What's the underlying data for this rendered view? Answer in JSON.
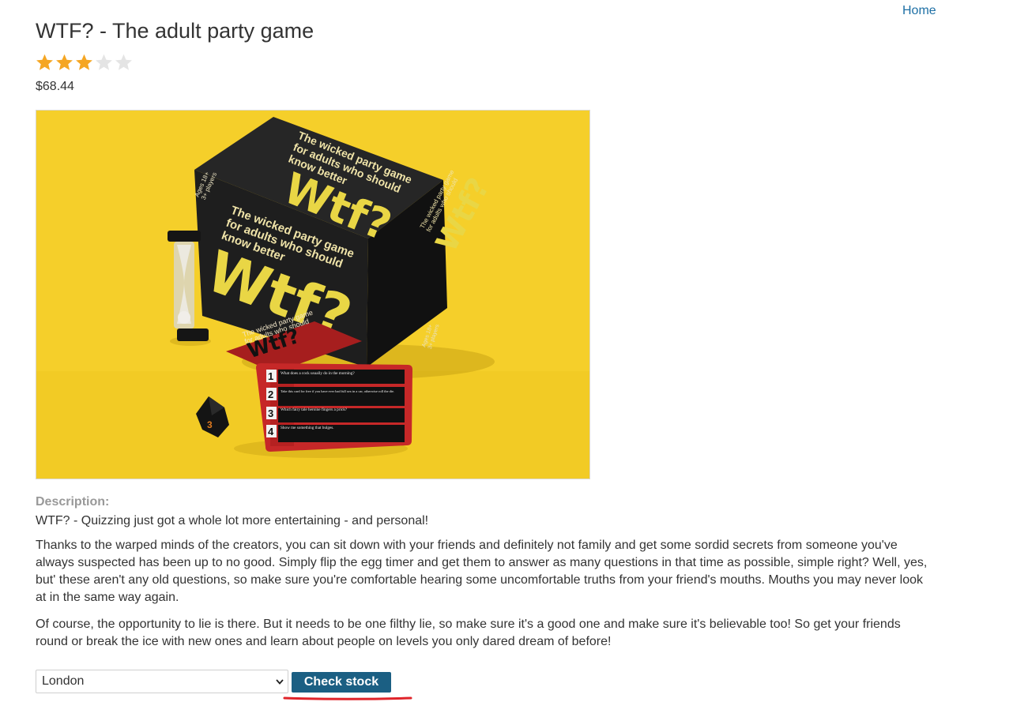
{
  "nav": {
    "home_label": "Home"
  },
  "product": {
    "title": "WTF? - The adult party game",
    "rating": 3,
    "rating_max": 5,
    "price": "$68.44",
    "image_alt": "WTF? - The adult party game",
    "image_text": {
      "box_tagline_lines": [
        "The wicked party game",
        "for adults who should",
        "know better"
      ],
      "logo": "Wtf?",
      "age_badge": "Ages 18+",
      "players_badge": "3+ players",
      "card_numbers": [
        "1",
        "2",
        "3",
        "4"
      ],
      "card_questions": [
        "What does a cock usually do in the morning?",
        "Take this card for free if you have ever had full sex in a car, otherwise roll the die.",
        "Which fairy tale heroine fingers a prick?",
        "Show me something that bulges."
      ],
      "die_number": "3"
    }
  },
  "description": {
    "label": "Description:",
    "paragraphs": [
      "WTF? - Quizzing just got a whole lot more entertaining - and personal!",
      "Thanks to the warped minds of the creators, you can sit down with your friends and definitely not family and get some sordid secrets from someone you've always suspected has been up to no good. Simply flip the egg timer and get them to answer as many questions in that time as possible, simple right? Well, yes, but' these aren't any old questions, so make sure you're comfortable hearing some uncomfortable truths from your friend's mouths. Mouths you may never look at in the same way again.",
      "Of course, the opportunity to lie is there. But it needs to be one filthy lie, so make sure it's a good one and make sure it's believable too! So get your friends round or break the ice with new ones and learn about people on levels you only dared dream of before!"
    ]
  },
  "stock_check": {
    "selected_store": "London",
    "button_label": "Check stock"
  },
  "colors": {
    "link": "#1d6fa5",
    "star_filled": "#f5a623",
    "star_empty": "#e4e4e4",
    "button_bg": "#1b5f83",
    "annotation": "#e0242a",
    "image_bg": "#f7d331"
  },
  "icons": {
    "rating": "star-icon",
    "select": "chevron-down-icon"
  }
}
